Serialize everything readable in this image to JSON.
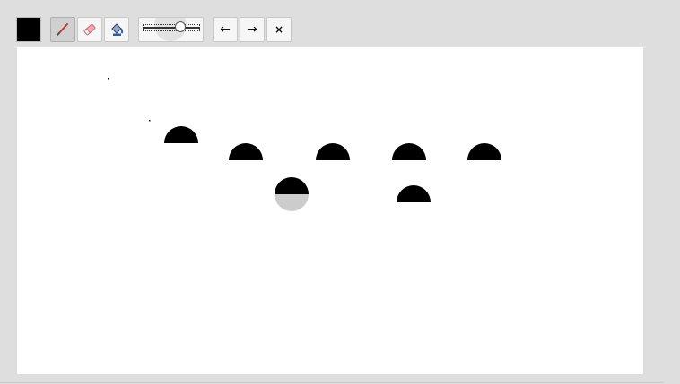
{
  "toolbar": {
    "current_color": "#000000",
    "tools": [
      {
        "name": "brush",
        "icon": "brush-icon",
        "active": true
      },
      {
        "name": "eraser",
        "icon": "eraser-icon",
        "active": false
      },
      {
        "name": "fill",
        "icon": "paint-bucket-icon",
        "active": false
      }
    ],
    "brush_size_level": 0.7,
    "history": {
      "undo_glyph": "←",
      "redo_glyph": "→",
      "clear_glyph": "×"
    }
  },
  "canvas": {
    "background": "#ffffff",
    "stroke_color": "#000000",
    "preview_color": "#cccccc"
  }
}
